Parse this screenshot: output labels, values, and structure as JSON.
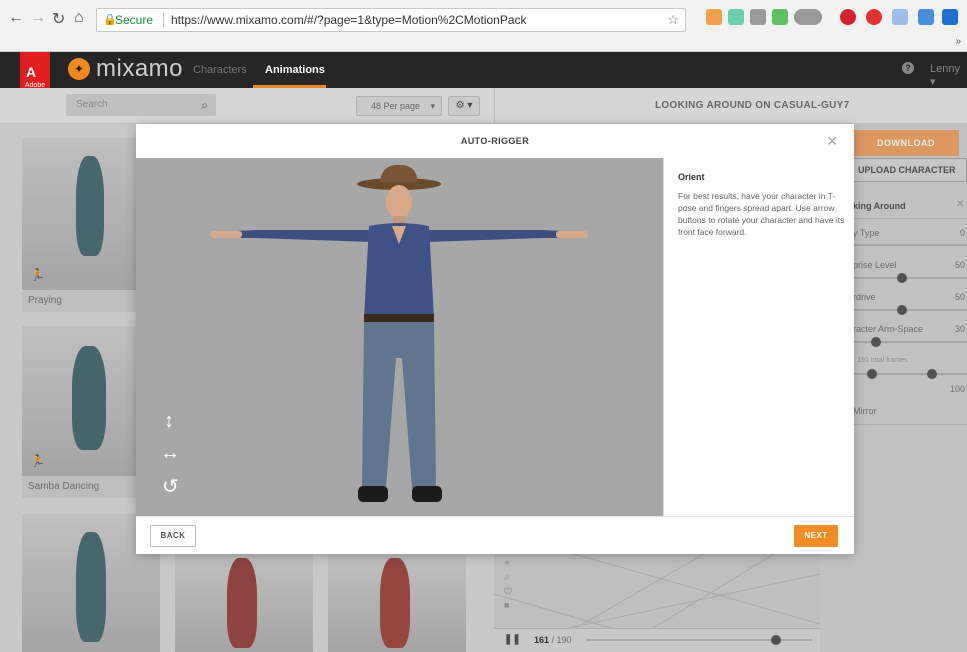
{
  "browser": {
    "secure_label": "Secure",
    "url": "https://www.mixamo.com/#/?page=1&type=Motion%2CMotionPack",
    "back_icon": "arrow-left",
    "forward_icon": "arrow-right",
    "reload_icon": "reload",
    "home_icon": "home"
  },
  "app": {
    "adobe_label": "Adobe",
    "brand": "mixamo",
    "nav": {
      "characters": "Characters",
      "animations": "Animations"
    },
    "user": "Lenny",
    "accent": "#f08a1d"
  },
  "toolbar": {
    "search_placeholder": "Search",
    "per_page": "48 Per page",
    "preview_title": "LOOKING AROUND ON CASUAL-GUY7"
  },
  "cards": [
    {
      "label": "Praying"
    },
    {
      "label": "Samba Dancing"
    }
  ],
  "side_panel": {
    "download": "DOWNLOAD",
    "upload": "UPLOAD CHARACTER",
    "anim_name": "king Around",
    "close": "✕",
    "rows": [
      {
        "label": "y Type",
        "value": "0"
      },
      {
        "label": "prise Level",
        "value": "50"
      },
      {
        "label": "rdrive",
        "value": "50"
      },
      {
        "label": "racter Arm-Space",
        "value": "30"
      },
      {
        "label": "- 191 total frames",
        "value": ""
      },
      {
        "label": "",
        "value": "100"
      },
      {
        "label": "Mirror",
        "value": ""
      }
    ]
  },
  "viewport": {
    "frame_current": "161",
    "frame_total": "/ 190",
    "progress": 0.84
  },
  "modal": {
    "title": "AUTO-RIGGER",
    "close": "✕",
    "info_heading": "Orient",
    "info_text": "For best results, have your character in T-pose and fingers spread apart. Use arrow buttons to rotate your character and have its front face forward.",
    "back": "BACK",
    "next": "NEXT"
  }
}
